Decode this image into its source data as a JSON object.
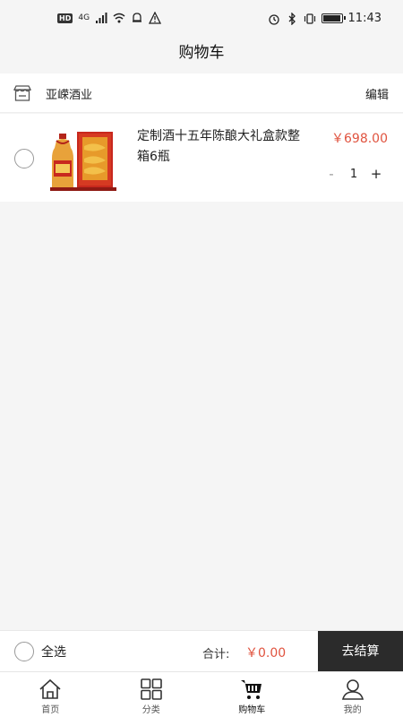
{
  "status_bar": {
    "network": "4G",
    "hd": "HD",
    "time": "11:43"
  },
  "header": {
    "title": "购物车"
  },
  "store": {
    "name": "亚嵘酒业",
    "edit_label": "编辑"
  },
  "items": [
    {
      "title": "定制酒十五年陈酿大礼盒款整箱6瓶",
      "price": "￥698.00",
      "quantity": "1",
      "minus": "-",
      "plus": "+"
    }
  ],
  "checkout": {
    "select_all_label": "全选",
    "total_label": "合计:",
    "total_value": "￥0.00",
    "button_label": "去结算"
  },
  "tabbar": {
    "tabs": [
      {
        "label": "首页",
        "icon": "home-icon"
      },
      {
        "label": "分类",
        "icon": "grid-icon"
      },
      {
        "label": "购物车",
        "icon": "cart-icon",
        "active": true
      },
      {
        "label": "我的",
        "icon": "user-icon"
      }
    ]
  },
  "colors": {
    "price": "#e0533f",
    "checkout_button": "#2b2b2b",
    "background": "#f5f5f5"
  }
}
